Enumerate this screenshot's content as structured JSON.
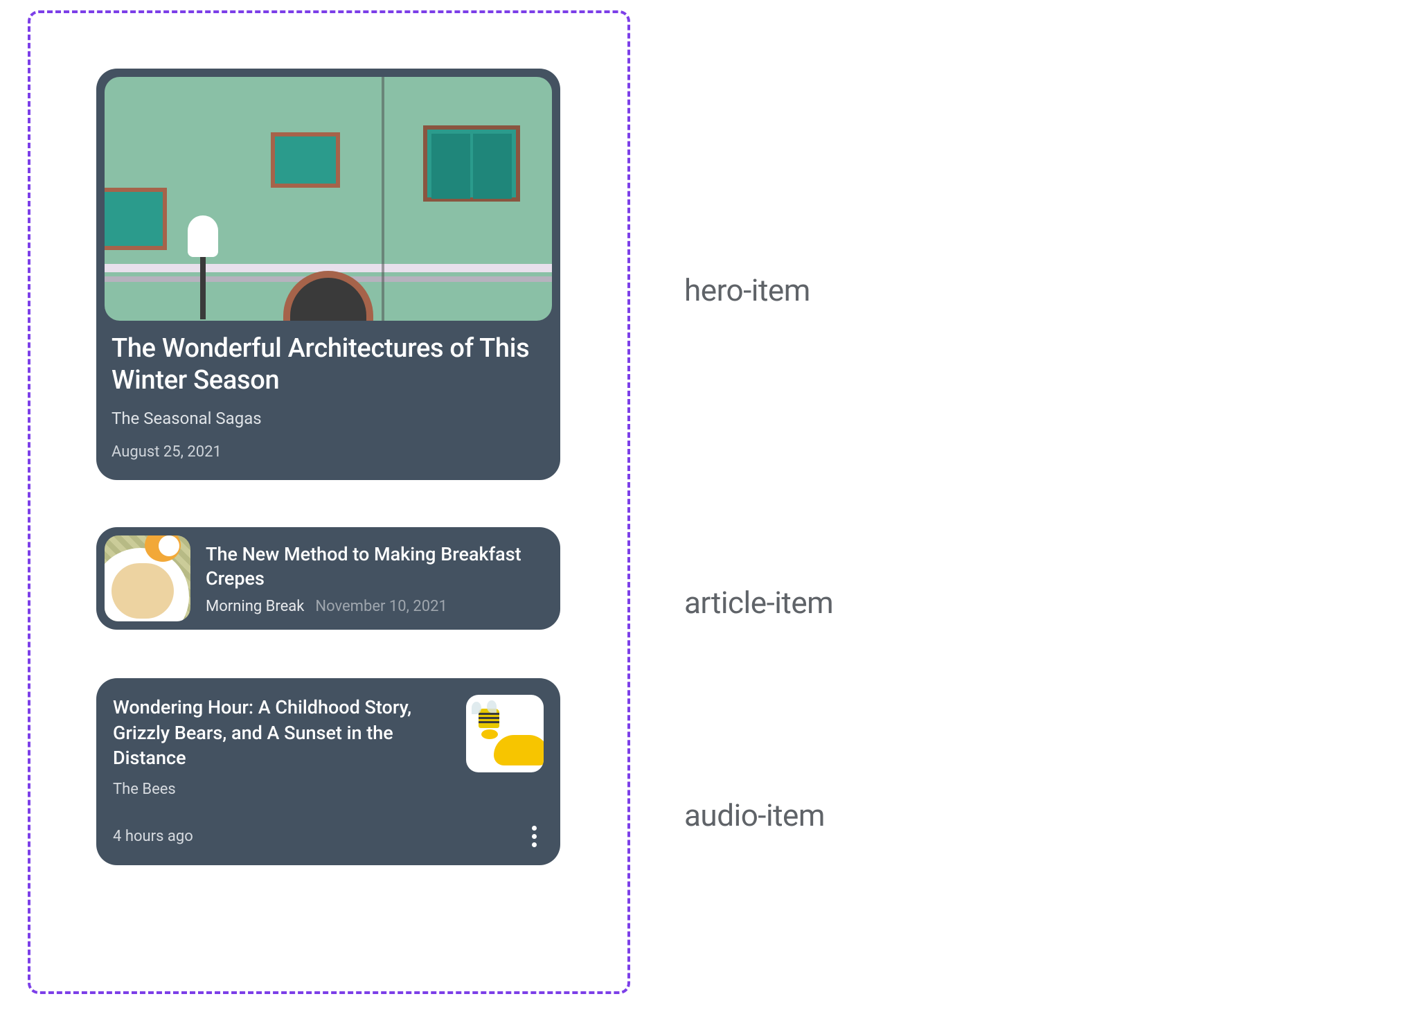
{
  "labels": {
    "hero": "hero-item",
    "article": "article-item",
    "audio": "audio-item"
  },
  "hero": {
    "title": "The Wonderful Architectures of This Winter Season",
    "source": "The Seasonal Sagas",
    "date": "August 25, 2021"
  },
  "article": {
    "title": "The New Method to Making Breakfast Crepes",
    "source": "Morning Break",
    "date": "November 10, 2021"
  },
  "audio": {
    "title": "Wondering Hour: A Childhood Story, Grizzly Bears, and A Sunset in the Distance",
    "source": "The Bees",
    "time": "4 hours ago"
  }
}
